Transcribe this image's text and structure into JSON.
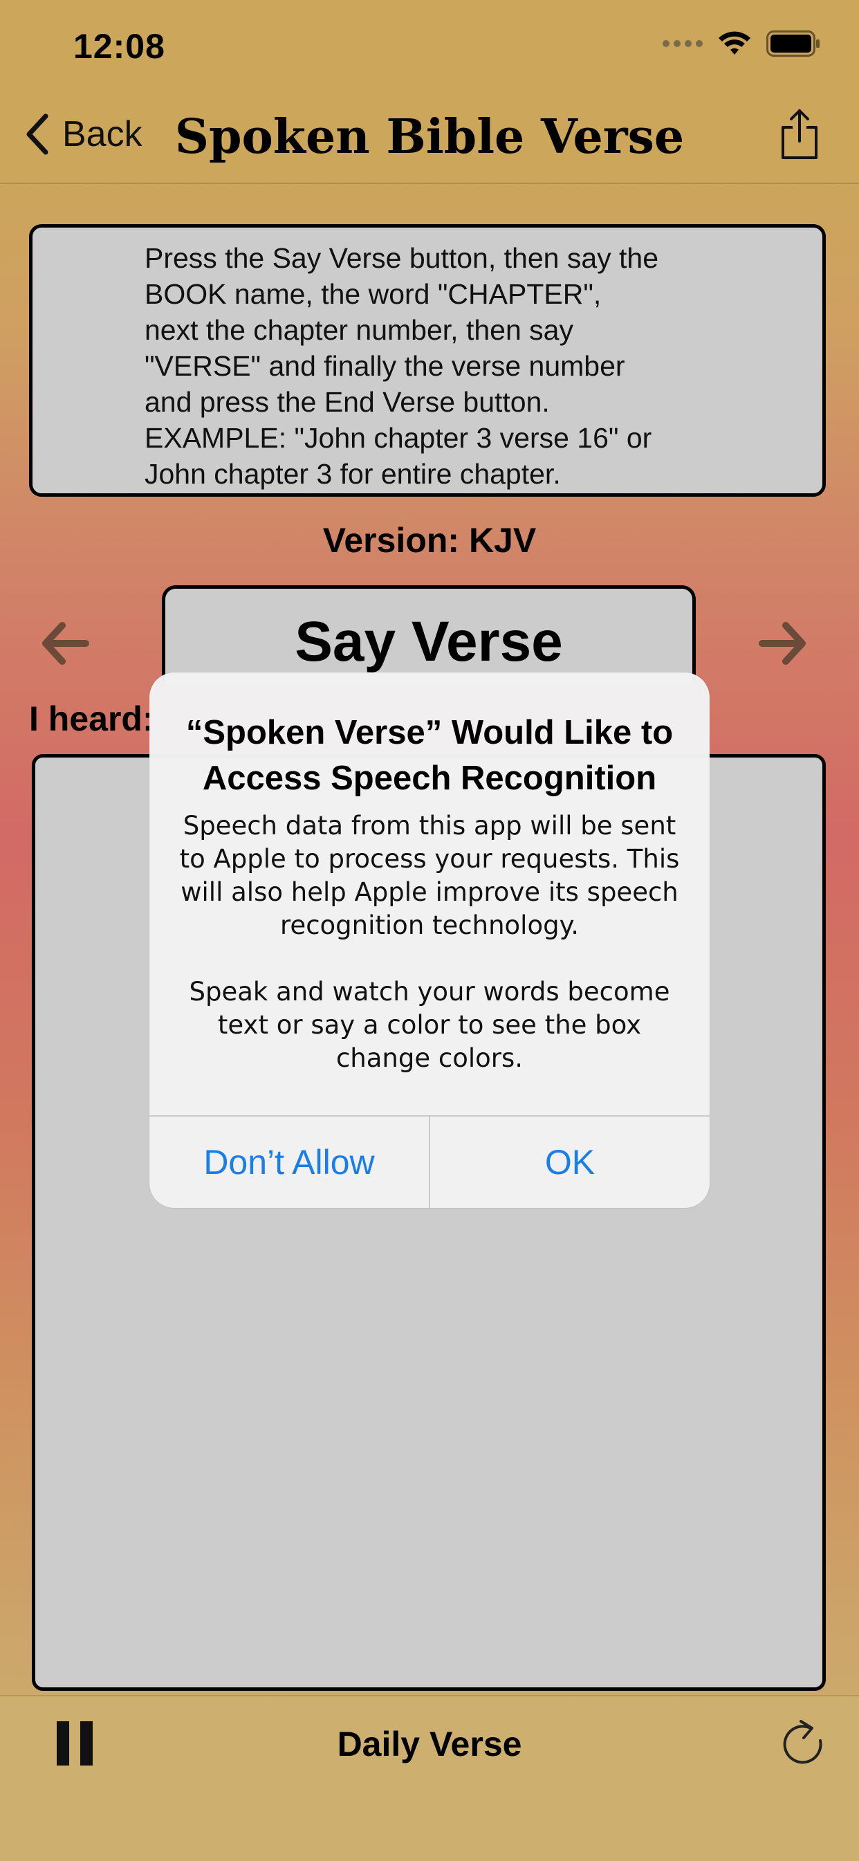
{
  "status": {
    "time": "12:08"
  },
  "nav": {
    "back_label": "Back",
    "title": "Spoken Bible Verse"
  },
  "instructions": [
    "Press the Say Verse button, then say the",
    "BOOK name, the word \"CHAPTER\",",
    "next the chapter number, then say",
    "\"VERSE\" and finally the verse number",
    "and press the End Verse button.",
    "EXAMPLE: \"John chapter 3 verse 16\" or",
    "John chapter 3 for entire chapter."
  ],
  "version_label": "Version: KJV",
  "say_verse_label": "Say Verse",
  "heard_label": "I heard:",
  "bottom": {
    "daily_verse_label": "Daily Verse"
  },
  "alert": {
    "title": "“Spoken Verse” Would Like to Access Speech Recognition",
    "message_1": "Speech data from this app will be sent to Apple to process your requests. This will also help Apple improve its speech recognition technology.",
    "message_2": "Speak and watch your words become text or say a color to see the box change colors.",
    "deny_label": "Don’t Allow",
    "ok_label": "OK"
  },
  "colors": {
    "accent": "#1a7ee6",
    "arrow": "#6b4a3a",
    "panel": "#cccccc"
  }
}
